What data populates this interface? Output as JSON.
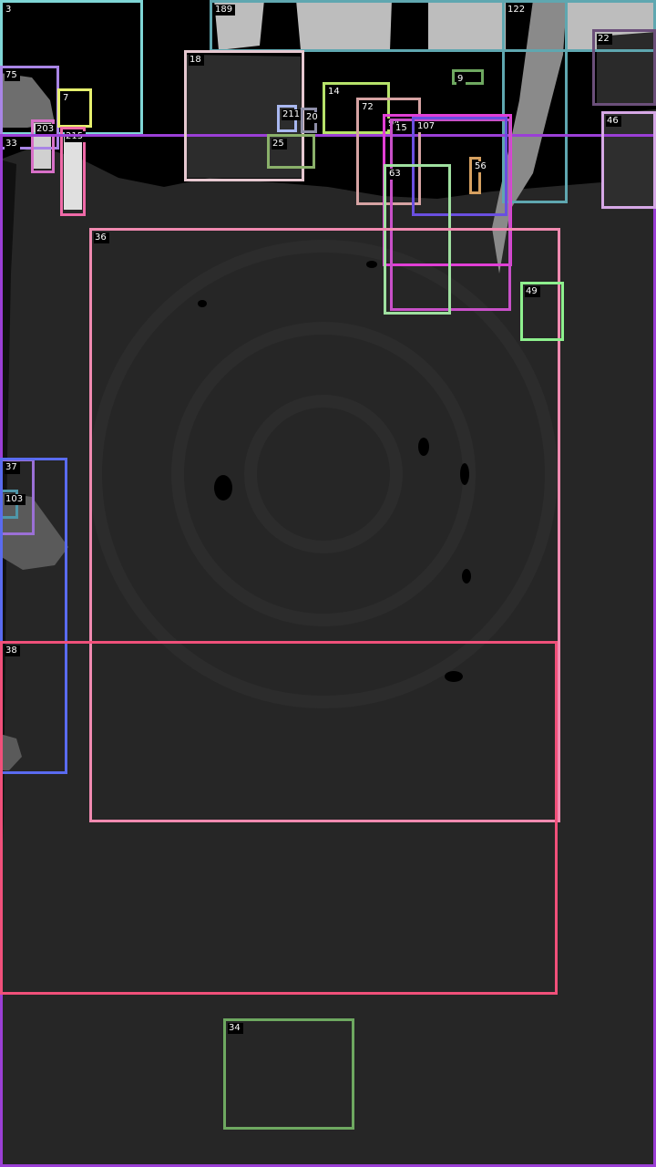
{
  "image": {
    "description_free": true
  },
  "colors": {
    "background_black": "#000000",
    "surface_dark_gray": "#262626",
    "mid_gray": "#3c3c3c",
    "light_gray": "#bdbdbd",
    "label_bg": "#000000",
    "label_text": "#ffffff"
  },
  "boxes": [
    {
      "label": "3",
      "color": "#7fd6d6"
    },
    {
      "label": "189",
      "color": "#5fa7b0"
    },
    {
      "label": "122",
      "color": "#5fa7b0"
    },
    {
      "label": "22",
      "color": "#6b4f7a"
    },
    {
      "label": "75",
      "color": "#a985e6"
    },
    {
      "label": "7",
      "color": "#e6f06e"
    },
    {
      "label": "203",
      "color": "#d870c8"
    },
    {
      "label": "215",
      "color": "#f06aa8"
    },
    {
      "label": "33",
      "color": "#9b3fd6"
    },
    {
      "label": "18",
      "color": "#e6c8d0"
    },
    {
      "label": "211",
      "color": "#a9b8f0"
    },
    {
      "label": "20",
      "color": "#8e8ea8"
    },
    {
      "label": "25",
      "color": "#8ab06a"
    },
    {
      "label": "14",
      "color": "#b6e26a"
    },
    {
      "label": "9",
      "color": "#6ea860"
    },
    {
      "label": "72",
      "color": "#d6a3a3"
    },
    {
      "label": "94",
      "color": "#e23fd6"
    },
    {
      "label": "15",
      "color": "#c850c8"
    },
    {
      "label": "107",
      "color": "#6a4fe0"
    },
    {
      "label": "56",
      "color": "#d6a060"
    },
    {
      "label": "63",
      "color": "#9fe0a0"
    },
    {
      "label": "46",
      "color": "#d6a8e6"
    },
    {
      "label": "36",
      "color": "#f08ab0"
    },
    {
      "label": "49",
      "color": "#8ef08e"
    },
    {
      "label": "90",
      "color": "#9b70d6"
    },
    {
      "label": "103",
      "color": "#4f96a8"
    },
    {
      "label": "37",
      "color": "#5a6bf0"
    },
    {
      "label": "38",
      "color": "#f0507a"
    },
    {
      "label": "34",
      "color": "#6ea860"
    }
  ]
}
